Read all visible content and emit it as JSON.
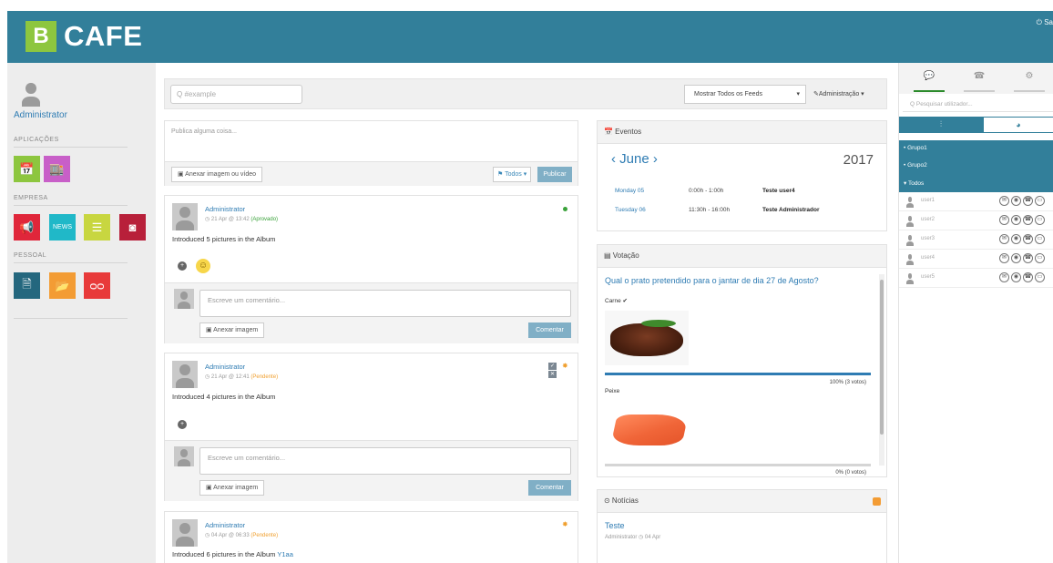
{
  "header": {
    "logo_letter": "B",
    "logo_text": "CAFE",
    "logout_label": "⏻ Sa"
  },
  "sidebar": {
    "user_name": "Administrator",
    "sections": [
      "APLICAÇÕES",
      "EMPRESA",
      "PESSOAL"
    ],
    "apps": [
      {
        "name": "calendar-app",
        "icon": "📅",
        "color": "#8dc63f"
      },
      {
        "name": "store-app",
        "icon": "🏬",
        "color": "#c85fc8"
      }
    ],
    "empresa": [
      {
        "name": "announcements-app",
        "icon": "📢",
        "color": "#e0263a"
      },
      {
        "name": "news-app",
        "icon": "NEWS",
        "color": "#20b8c8"
      },
      {
        "name": "documents-app",
        "icon": "☰",
        "color": "#c8d640"
      },
      {
        "name": "gallery-app",
        "icon": "◙",
        "color": "#b8203a"
      }
    ],
    "pessoal": [
      {
        "name": "profile-app",
        "icon": "🗎",
        "color": "#24677e"
      },
      {
        "name": "files-app",
        "icon": "📂",
        "color": "#f39c34"
      },
      {
        "name": "voicemail-app",
        "icon": "ᴑᴑ",
        "color": "#e83a3a"
      }
    ]
  },
  "toolbar": {
    "search_placeholder": "Q  #example",
    "feeds_select": "Mostrar Todos os Feeds",
    "admin_menu": "✎Administração ▾"
  },
  "compose": {
    "placeholder": "Publica alguma coisa...",
    "attach_label": "▣ Anexar imagem ou vídeo",
    "audience_label": "⚑ Todos ▾",
    "publish_label": "Publicar"
  },
  "posts": [
    {
      "author": "Administrator",
      "date": "◷ 21 Apr @ 13:42",
      "status": "(Aprovado)",
      "text": "Introduced 5 pictures in the Album",
      "link": "",
      "comment_placeholder": "Escreve um comentário...",
      "attach_label": "▣ Anexar imagem",
      "comment_label": "Comentar"
    },
    {
      "author": "Administrator",
      "date": "◷ 21 Apr @ 12:41",
      "status": "(Pendente)",
      "text": "Introduced 4 pictures in the Album",
      "link": "",
      "comment_placeholder": "Escreve um comentário...",
      "attach_label": "▣ Anexar imagem",
      "comment_label": "Comentar"
    },
    {
      "author": "Administrator",
      "date": "◷ 04 Apr @ 06:33",
      "status": "(Pendente)",
      "text": "Introduced 6 pictures in the Album ",
      "link": "Y1aa"
    }
  ],
  "events": {
    "title": "📅 Eventos",
    "month": "‹ June ›",
    "year": "2017",
    "items": [
      {
        "date": "Monday 05",
        "time": "0:00h - 1:00h",
        "title": "Teste user4"
      },
      {
        "date": "Tuesday 06",
        "time": "11:30h - 16:00h",
        "title": "Teste Administrador"
      }
    ]
  },
  "poll": {
    "title": "▤ Votação",
    "question": "Qual o prato pretendido para o jantar de dia 27 de Agosto?",
    "options": [
      {
        "label": "Carne ✔",
        "percent": 100,
        "result": "100% (3 votos)"
      },
      {
        "label": "Peixe",
        "percent": 0,
        "result": "0% (0 votos)"
      }
    ]
  },
  "news": {
    "title": "⊙ Notícias",
    "item_title": "Teste",
    "item_meta": "Administrator ◷ 04 Apr"
  },
  "chat": {
    "tabs": [
      "💬",
      "☎",
      "⚙"
    ],
    "search_placeholder": "Q  Pesquisar utilizador...",
    "seg_left": "⫶",
    "seg_right": "◕",
    "groups": [
      "• Grupo1",
      "• Grupo2",
      "▾ Todos"
    ],
    "users": [
      "user1",
      "user2",
      "user3",
      "user4",
      "user5"
    ]
  }
}
